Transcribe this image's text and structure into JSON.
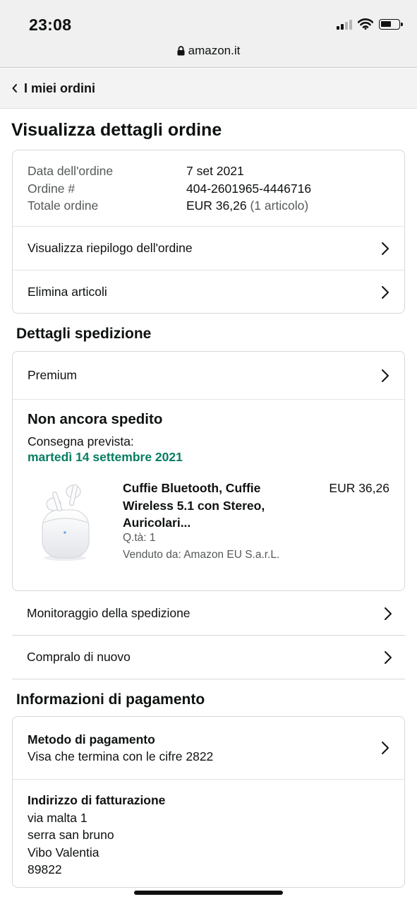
{
  "status_bar": {
    "time": "23:08"
  },
  "browser": {
    "url": "amazon.it"
  },
  "nav": {
    "back_label": "I miei ordini"
  },
  "page": {
    "title": "Visualizza dettagli ordine"
  },
  "order_summary": {
    "rows": [
      {
        "label": "Data dell'ordine",
        "value": "7 set 2021"
      },
      {
        "label": "Ordine #",
        "value": "404-2601965-4446716"
      },
      {
        "label": "Totale ordine",
        "value": "EUR 36,26",
        "extra": "(1 articolo)"
      }
    ],
    "links": [
      {
        "label": "Visualizza riepilogo dell'ordine"
      },
      {
        "label": "Elimina articoli"
      }
    ]
  },
  "shipping": {
    "heading": "Dettagli spedizione",
    "service": "Premium",
    "status_title": "Non ancora spedito",
    "delivery_label": "Consegna prevista:",
    "delivery_date": "martedì 14 settembre 2021",
    "item": {
      "title_line1": "Cuffie Bluetooth, Cuffie",
      "title_line2": "Wireless 5.1 con Stereo,",
      "title_line3": "Auricolari...",
      "price": "EUR 36,26",
      "qty": "Q.tà: 1",
      "seller": "Venduto da: Amazon EU S.a.r.L."
    },
    "actions": [
      {
        "label": "Monitoraggio della spedizione"
      },
      {
        "label": "Compralo di nuovo"
      }
    ]
  },
  "payment": {
    "heading": "Informazioni di pagamento",
    "method_title": "Metodo di pagamento",
    "method_value": "Visa che termina con le cifre 2822",
    "billing_title": "Indirizzo di fatturazione",
    "billing_lines": [
      "via malta 1",
      "serra san bruno",
      "Vibo Valentia",
      "89822"
    ]
  },
  "colors": {
    "delivery_green": "#067d62",
    "border": "#d5d9d9"
  },
  "icons": [
    "wifi-icon",
    "signal-icon",
    "battery-icon",
    "lock-icon",
    "chevron-left-icon",
    "chevron-right-icon"
  ]
}
